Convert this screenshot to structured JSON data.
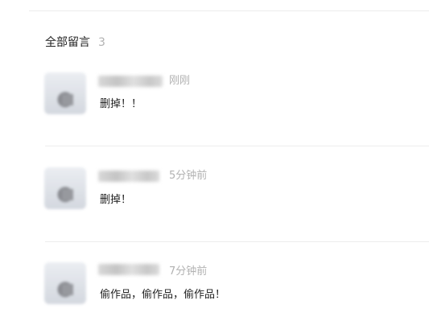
{
  "comments_section": {
    "title": "全部留言",
    "count": "3"
  },
  "comments": [
    {
      "time": "刚刚",
      "text": "删掉！！"
    },
    {
      "time": "5分钟前",
      "text": "删掉！"
    },
    {
      "time": "7分钟前",
      "text": "偷作品，偷作品，偷作品！"
    }
  ]
}
